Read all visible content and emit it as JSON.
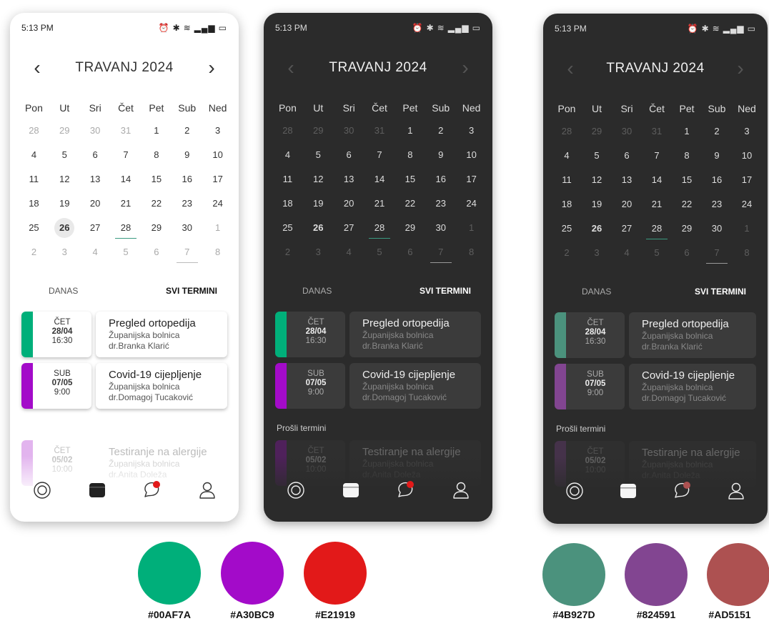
{
  "status_time": "5:13 PM",
  "month_title": "TRAVANJ 2024",
  "weekdays": [
    "Pon",
    "Ut",
    "Sri",
    "Čet",
    "Pet",
    "Sub",
    "Ned"
  ],
  "weeks": [
    [
      "28",
      "29",
      "30",
      "31",
      "1",
      "2",
      "3"
    ],
    [
      "4",
      "5",
      "6",
      "7",
      "8",
      "9",
      "10"
    ],
    [
      "11",
      "12",
      "13",
      "14",
      "15",
      "16",
      "17"
    ],
    [
      "18",
      "19",
      "20",
      "21",
      "22",
      "23",
      "24"
    ],
    [
      "25",
      "26",
      "27",
      "28",
      "29",
      "30",
      "1"
    ],
    [
      "2",
      "3",
      "4",
      "5",
      "6",
      "7",
      "8"
    ]
  ],
  "tabs": {
    "today": "DANAS",
    "all": "SVI TERMINI"
  },
  "appointments": [
    {
      "day": "ČET",
      "date": "28/04",
      "time": "16:30",
      "title": "Pregled ortopedija",
      "place": "Županijska bolnica",
      "doctor": "dr.Branka Klarić"
    },
    {
      "day": "SUB",
      "date": "07/05",
      "time": "9:00",
      "title": "Covid-19 cijepljenje",
      "place": "Županijska bolnica",
      "doctor": "dr.Domagoj Tucaković"
    }
  ],
  "past_label": "Prošli termini",
  "past_appointment": {
    "day": "ČET",
    "date": "05/02",
    "time": "10:00",
    "title": "Testiranje na alergije",
    "place": "Županijska bolnica",
    "doctor": "dr.Anita Doleža"
  },
  "palette_light": [
    "#00AF7A",
    "#A30BC9",
    "#E21919"
  ],
  "palette_dark": [
    "#4B927D",
    "#824591",
    "#AD5151"
  ]
}
